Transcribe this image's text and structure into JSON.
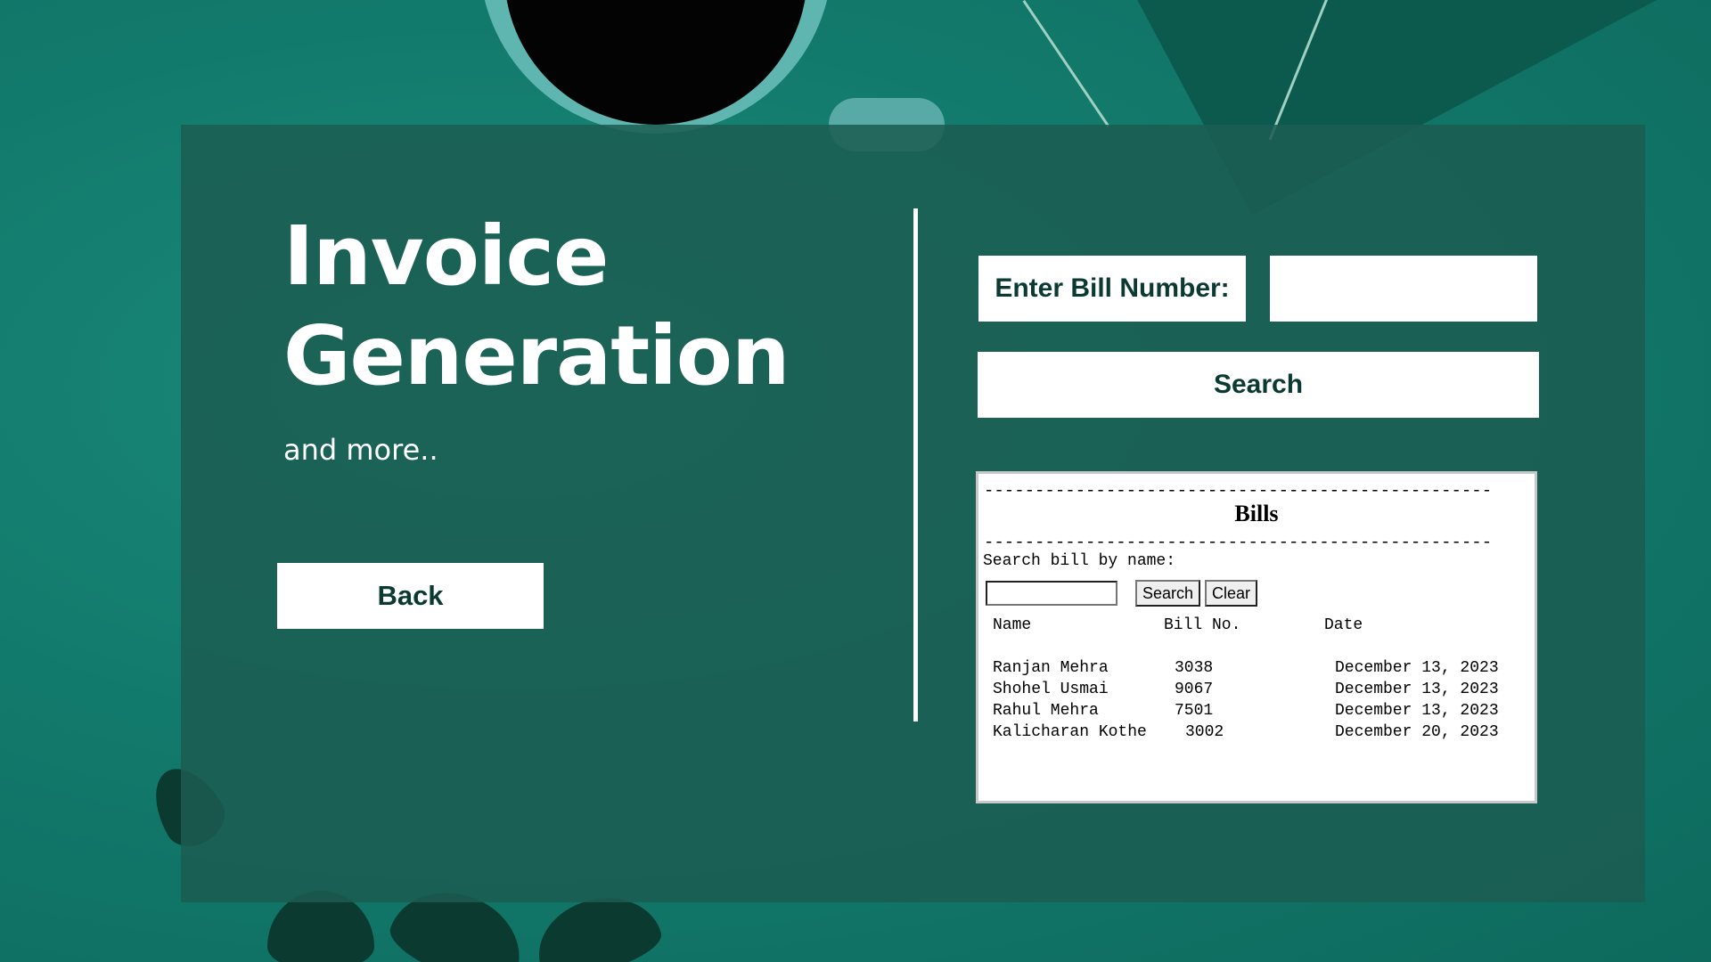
{
  "left": {
    "title_line1": "Invoice",
    "title_line2": "Generation",
    "subtitle": "and more..",
    "back_label": "Back"
  },
  "bill_search": {
    "label": "Enter Bill Number:",
    "input_value": "",
    "search_label": "Search"
  },
  "bills": {
    "heading": "Bills",
    "dash_line": "--------------------------------------------------",
    "search_label": "Search bill by name:",
    "name_input_value": "",
    "search_button": "Search",
    "clear_button": "Clear",
    "columns": [
      "Name",
      "Bill No.",
      "Date"
    ],
    "rows": [
      {
        "name": "Ranjan Mehra",
        "bill_no": "3038",
        "date": "December 13, 2023"
      },
      {
        "name": "Shohel Usmai",
        "bill_no": "9067",
        "date": "December 13, 2023"
      },
      {
        "name": "Rahul Mehra",
        "bill_no": "7501",
        "date": "December 13, 2023"
      },
      {
        "name": "Kalicharan Kothe",
        "bill_no": "3002",
        "date": "December 20, 2023"
      }
    ]
  },
  "colors": {
    "background": "#127a6c",
    "panel": "#1c5c52",
    "button_text": "#0b3a33"
  }
}
